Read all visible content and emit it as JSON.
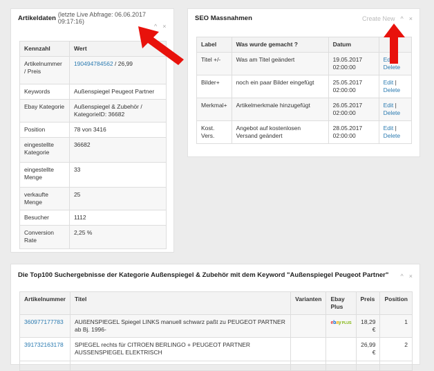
{
  "artikeldaten": {
    "title": "Artikeldaten",
    "subtitle": "(letzte Live Abfrage: 06.06.2017 09:17:16)",
    "headers": [
      "Kennzahl",
      "Wert"
    ],
    "rows": [
      {
        "label": "Artikelnummer / Preis",
        "link": "190494784562",
        "suffix": " / 26,99"
      },
      {
        "label": "Keywords",
        "value": "Außenspiegel Peugeot Partner"
      },
      {
        "label": "Ebay Kategorie",
        "value": "Außenspiegel & Zubehör / KategorieID: 36682"
      },
      {
        "label": "Position",
        "value": "78 von 3416"
      },
      {
        "label": "eingestellte Kategorie",
        "value": "36682"
      },
      {
        "label": "eingestellte Menge",
        "value": "33"
      },
      {
        "label": "verkaufte Menge",
        "value": "25"
      },
      {
        "label": "Besucher",
        "value": "1112"
      },
      {
        "label": "Conversion Rate",
        "value": "2,25 %"
      }
    ]
  },
  "seo": {
    "title": "SEO Massnahmen",
    "create_new": "Create New",
    "headers": [
      "Label",
      "Was wurde gemacht ?",
      "Datum",
      ""
    ],
    "rows": [
      {
        "label": "Titel +/-",
        "what": "Was am Titel geändert",
        "date": "19.05.2017 02:00:00"
      },
      {
        "label": "Bilder+",
        "what": "noch ein paar Bilder eingefügt",
        "date": "25.05.2017 02:00:00"
      },
      {
        "label": "Merkmal+",
        "what": "Artikelmerkmale hinzugefügt",
        "date": "26.05.2017 02:00:00"
      },
      {
        "label": "Kost. Vers.",
        "what": "Angebot auf kostenlosen Versand geändert",
        "date": "28.05.2017 02:00:00"
      }
    ],
    "edit_label": "Edit",
    "separator": "|",
    "delete_label": "Delete"
  },
  "top100": {
    "title": "Die Top100 Suchergebnisse der Kategorie Außenspiegel & Zubehör mit dem Keyword \"Außenspiegel Peugeot Partner\"",
    "headers": [
      "Artikelnummer",
      "Titel",
      "Varianten",
      "Ebay Plus",
      "Preis",
      "Position"
    ],
    "rows": [
      {
        "id": "360977177783",
        "title": "AUßENSPIEGEL Spiegel LINKS manuell schwarz paßt zu PEUGEOT PARTNER ab Bj. 1996-",
        "variants": "",
        "ebay_plus": true,
        "price": "18,29 €",
        "position": "1"
      },
      {
        "id": "391732163178",
        "title": "SPIEGEL rechts für CITROEN BERLINGO + PEUGEOT PARTNER AUSSENSPIEGEL ELEKTRISCH",
        "variants": "",
        "ebay_plus": false,
        "price": "26,99 €",
        "position": "2"
      }
    ]
  },
  "ebay_plus_badge": {
    "e": "e",
    "b": "b",
    "a": "a",
    "y": "y",
    "plus": "PLUS"
  },
  "controls": {
    "collapse": "^",
    "close": "×"
  },
  "colors": {
    "link": "#2a7ab0",
    "arrow": "#e8120c",
    "header_bg": "#f3f3f3"
  },
  "icons": {
    "collapse": "chevron-up-icon",
    "close": "close-icon",
    "annotation": "red-arrow-icon"
  }
}
